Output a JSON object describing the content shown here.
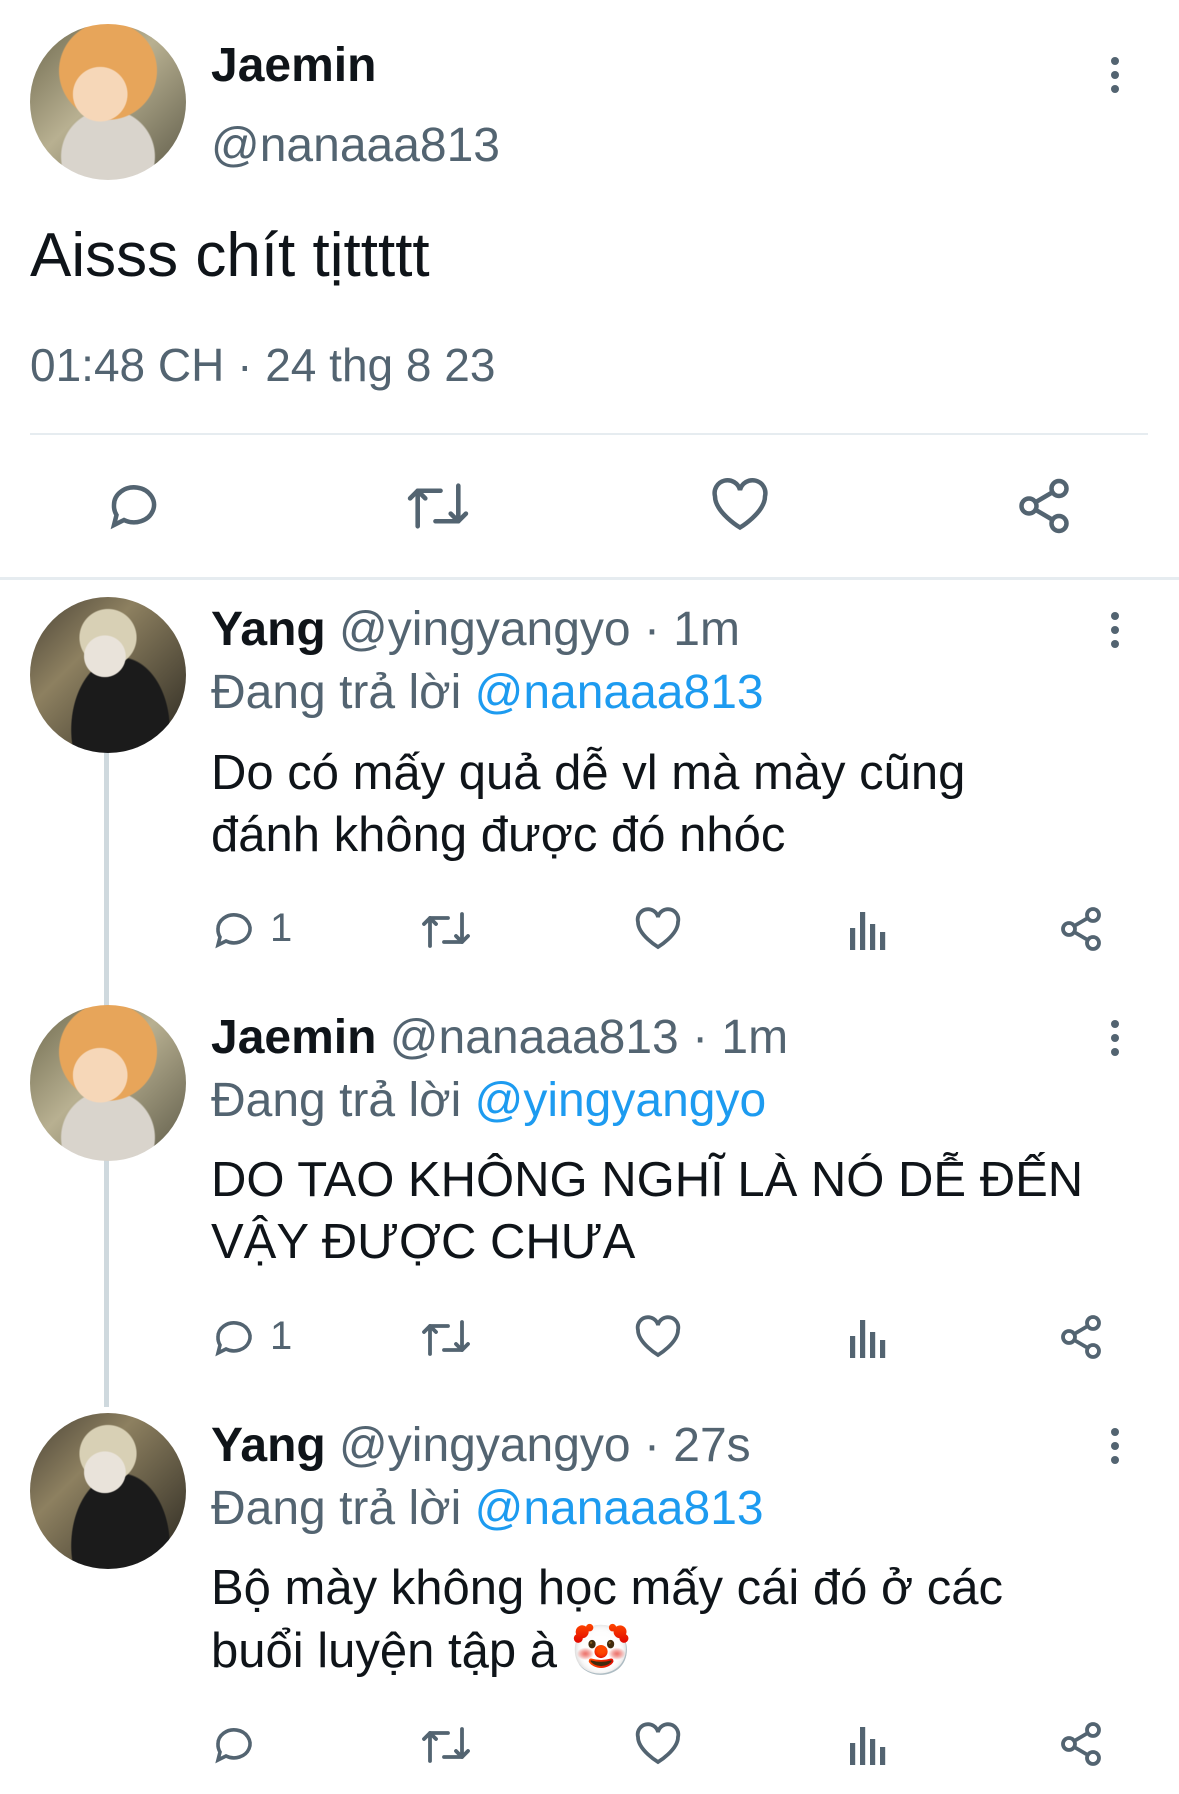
{
  "main_tweet": {
    "name": "Jaemin",
    "handle": "@nanaaa813",
    "text": "Aisss chít tịttttt",
    "timestamp": "01:48 CH · 24 thg 8 23"
  },
  "replies": [
    {
      "name": "Yang",
      "meta": "@yingyangyo · 1m",
      "replying_prefix": "Đang trả lời",
      "replying_to": "@nanaaa813",
      "text_line1": "Do có mấy quả dễ vl mà mày cũng",
      "text_line2": "đánh không được đó nhóc",
      "reply_count": "1"
    },
    {
      "name": "Jaemin",
      "meta": "@nanaaa813 · 1m",
      "replying_prefix": "Đang trả lời",
      "replying_to": "@yingyangyo",
      "text_line1": "DO TAO KHÔNG NGHĨ LÀ NÓ DỄ ĐẾN",
      "text_line2": "VẬY ĐƯỢC CHƯA",
      "reply_count": "1"
    },
    {
      "name": "Yang",
      "meta": "@yingyangyo · 27s",
      "replying_prefix": "Đang trả lời",
      "replying_to": "@nanaaa813",
      "text_line1": "Bộ mày không học mấy cái đó ở các",
      "text_line2": "buổi luyện tập à 🤡",
      "reply_count": ""
    }
  ],
  "colors": {
    "link": "#1d9bf0",
    "muted": "#536471",
    "divider": "#e6ecf0"
  },
  "icons": [
    "reply-icon",
    "retweet-icon",
    "like-icon",
    "share-icon",
    "views-icon",
    "more-icon"
  ]
}
